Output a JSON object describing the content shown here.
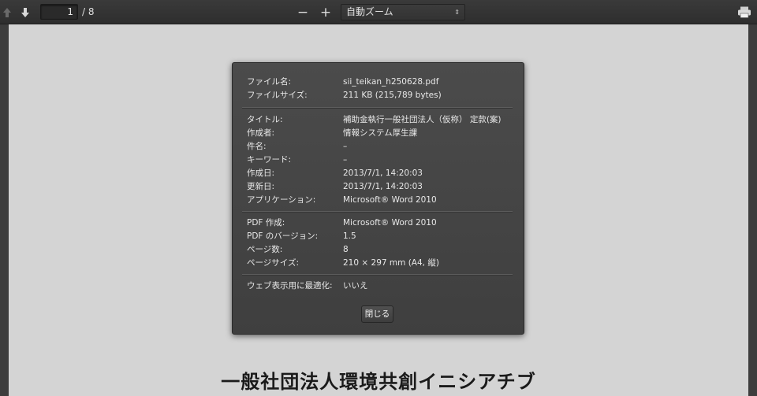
{
  "toolbar": {
    "page_current": "1",
    "page_total": "/ 8",
    "zoom_minus": "−",
    "zoom_plus": "+",
    "zoom_value": "自動ズーム",
    "zoom_arrows": "⇕",
    "icons": [
      "arrow-up-icon",
      "arrow-down-icon",
      "print-icon"
    ]
  },
  "dialog": {
    "file": [
      {
        "label": "ファイル名:",
        "value": "sii_teikan_h250628.pdf"
      },
      {
        "label": "ファイルサイズ:",
        "value": "211 KB (215,789 bytes)"
      }
    ],
    "doc": [
      {
        "label": "タイトル:",
        "value": "補助金執行一般社団法人（仮称） 定款(案)"
      },
      {
        "label": "作成者:",
        "value": "情報システム厚生課"
      },
      {
        "label": "件名:",
        "value": "–"
      },
      {
        "label": "キーワード:",
        "value": "–"
      },
      {
        "label": "作成日:",
        "value": "2013/7/1, 14:20:03"
      },
      {
        "label": "更新日:",
        "value": "2013/7/1, 14:20:03"
      },
      {
        "label": "アプリケーション:",
        "value": "Microsoft® Word 2010"
      }
    ],
    "pdf": [
      {
        "label": "PDF 作成:",
        "value": "Microsoft® Word 2010"
      },
      {
        "label": "PDF のバージョン:",
        "value": "1.5"
      },
      {
        "label": "ページ数:",
        "value": "8"
      },
      {
        "label": "ページサイズ:",
        "value": "210 × 297 mm (A4, 縦)"
      }
    ],
    "web": {
      "label": "ウェブ表示用に最適化:",
      "value": "いいえ"
    },
    "close_label": "閉じる"
  },
  "document": {
    "heading": "一般社団法人環境共創イニシアチブ"
  }
}
